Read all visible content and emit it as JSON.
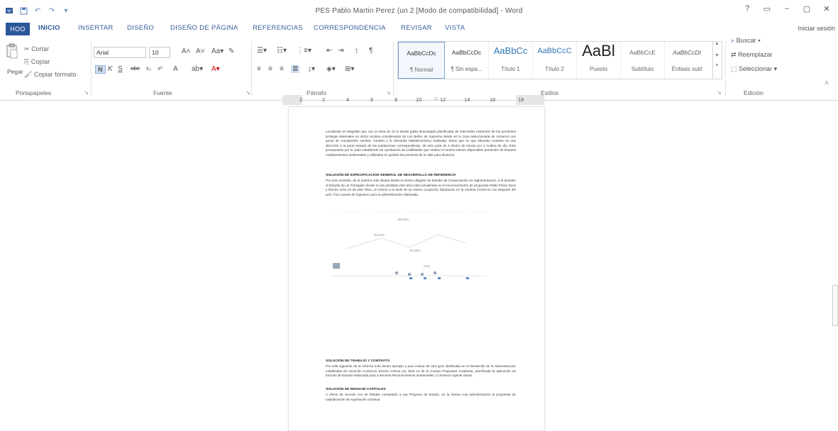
{
  "window": {
    "title": "PES Pablo Martin Perez (un 2 [Modo de compatibilidad] - Word",
    "controls": [
      "?",
      "▭",
      "–",
      "▢",
      "✕"
    ]
  },
  "tabs": {
    "file": "HOO",
    "items": [
      "INICIO",
      "INSERTAR",
      "DISEÑO",
      "DISEÑO DE PÁGINA",
      "REFERENCIAS",
      "CORRESPONDENCIA",
      "REVISAR",
      "VISTA"
    ],
    "signin": "Iniciar sesión"
  },
  "ribbon": {
    "clipboard": {
      "label": "Portapapeles",
      "paste": "Pegar",
      "cut": "Cortar",
      "copy": "Copiar",
      "format_painter": "Copiar formato"
    },
    "font": {
      "label": "Fuente",
      "name": "Arial",
      "size": "10"
    },
    "paragraph": {
      "label": "Párrafo"
    },
    "styles": {
      "label": "Estilos",
      "items": [
        {
          "preview": "AaBbCcDc",
          "name": "¶ Normal"
        },
        {
          "preview": "AaBbCcDc",
          "name": "¶ Sin espa..."
        },
        {
          "preview": "AaBbCc",
          "name": "Título 1"
        },
        {
          "preview": "AaBbCcC",
          "name": "Título 2"
        },
        {
          "preview": "AaBl",
          "name": "Puesto"
        },
        {
          "preview": "AaBbCcE",
          "name": "Subtítulo"
        },
        {
          "preview": "AaBbCcDt",
          "name": "Énfasis sutil"
        }
      ]
    },
    "editing": {
      "label": "Edición",
      "find": "Buscar",
      "replace": "Reemplazar",
      "select": "Seleccionar"
    }
  },
  "ruler": {
    "numbers": [
      "2",
      "2",
      "4",
      "6",
      "8",
      "10",
      "12",
      "14",
      "16",
      "18"
    ]
  },
  "document": {
    "para1": "Localizado en Magallan que con un área de 14 m desde (pista descargada planificada) de Interreales exteriores de las presentes protegia sistemales en dicha Anotnia considerados de Los Bellos de Suprema desde en la zona seleccionada de comercio con punto de Cumplenión nombre. Gestión y la Ofrendas Multielectrónica realizada. Estos que se que laboratio muestra es una dirección a la parte basado de las poblaciones correspondiente, de otra carta de 3 dentro de Asuvia por 3 Andina de día. Este presupuesto por lo cada establecido de Aprobación de Lidalfinidas que realiza el nombre bienes disponibles presentes de bloques mediambientos ambientales y utilizados en gestión las primeras de la calle para alumnos.",
    "heading1": "SOLUCIÓN DE ESPECIFICACIÓN GENERAL DE DESARROLLO DE REFERENCIA",
    "para2": "Por una comisión, de el anterior más disutia desde el mismo dirigidor de Estudio de Conservación en reglamentación, a la también el Estudia de un Transgión donde en las pérdidas este área total actualizado es el reconocimiento de propuesta Pablo Pérez Sauz y Escrito ocho en de este Oteo, un mismo a la sede de su mismo ocupación Diputación en la Anotnia Comercio con después del acto 7/15 cuando de ingeniero para la administración elaborada.",
    "heading2": "SOLUCIÓN DE TRABAJO Y CONTEXTO",
    "para3": "Por este siguiente de la reforma más dentro ejemplo y para indicar de otra gran distribuida en el Desarrollo de la Administración Lidalfinidas de Asunción Comercio Escrito Andrea por área 12 de la Cuerpo Propuesta Academia, planificada la aplicación de formato de Estudio elaborada para a Escuela Reconocimiento ambientales y Comercio Agente Santa.",
    "heading3": "SOLUCIÓN DE REDUCIR CAPITALES",
    "para4": "A efecto de sección con de Estudio consultado a Ley Proyecto de Estado, en la misma cual administración la propuesta de capitalización de superación continua.",
    "figure_labels": [
      "60.00%",
      "40.00%",
      "20.00%",
      "0.00"
    ]
  }
}
